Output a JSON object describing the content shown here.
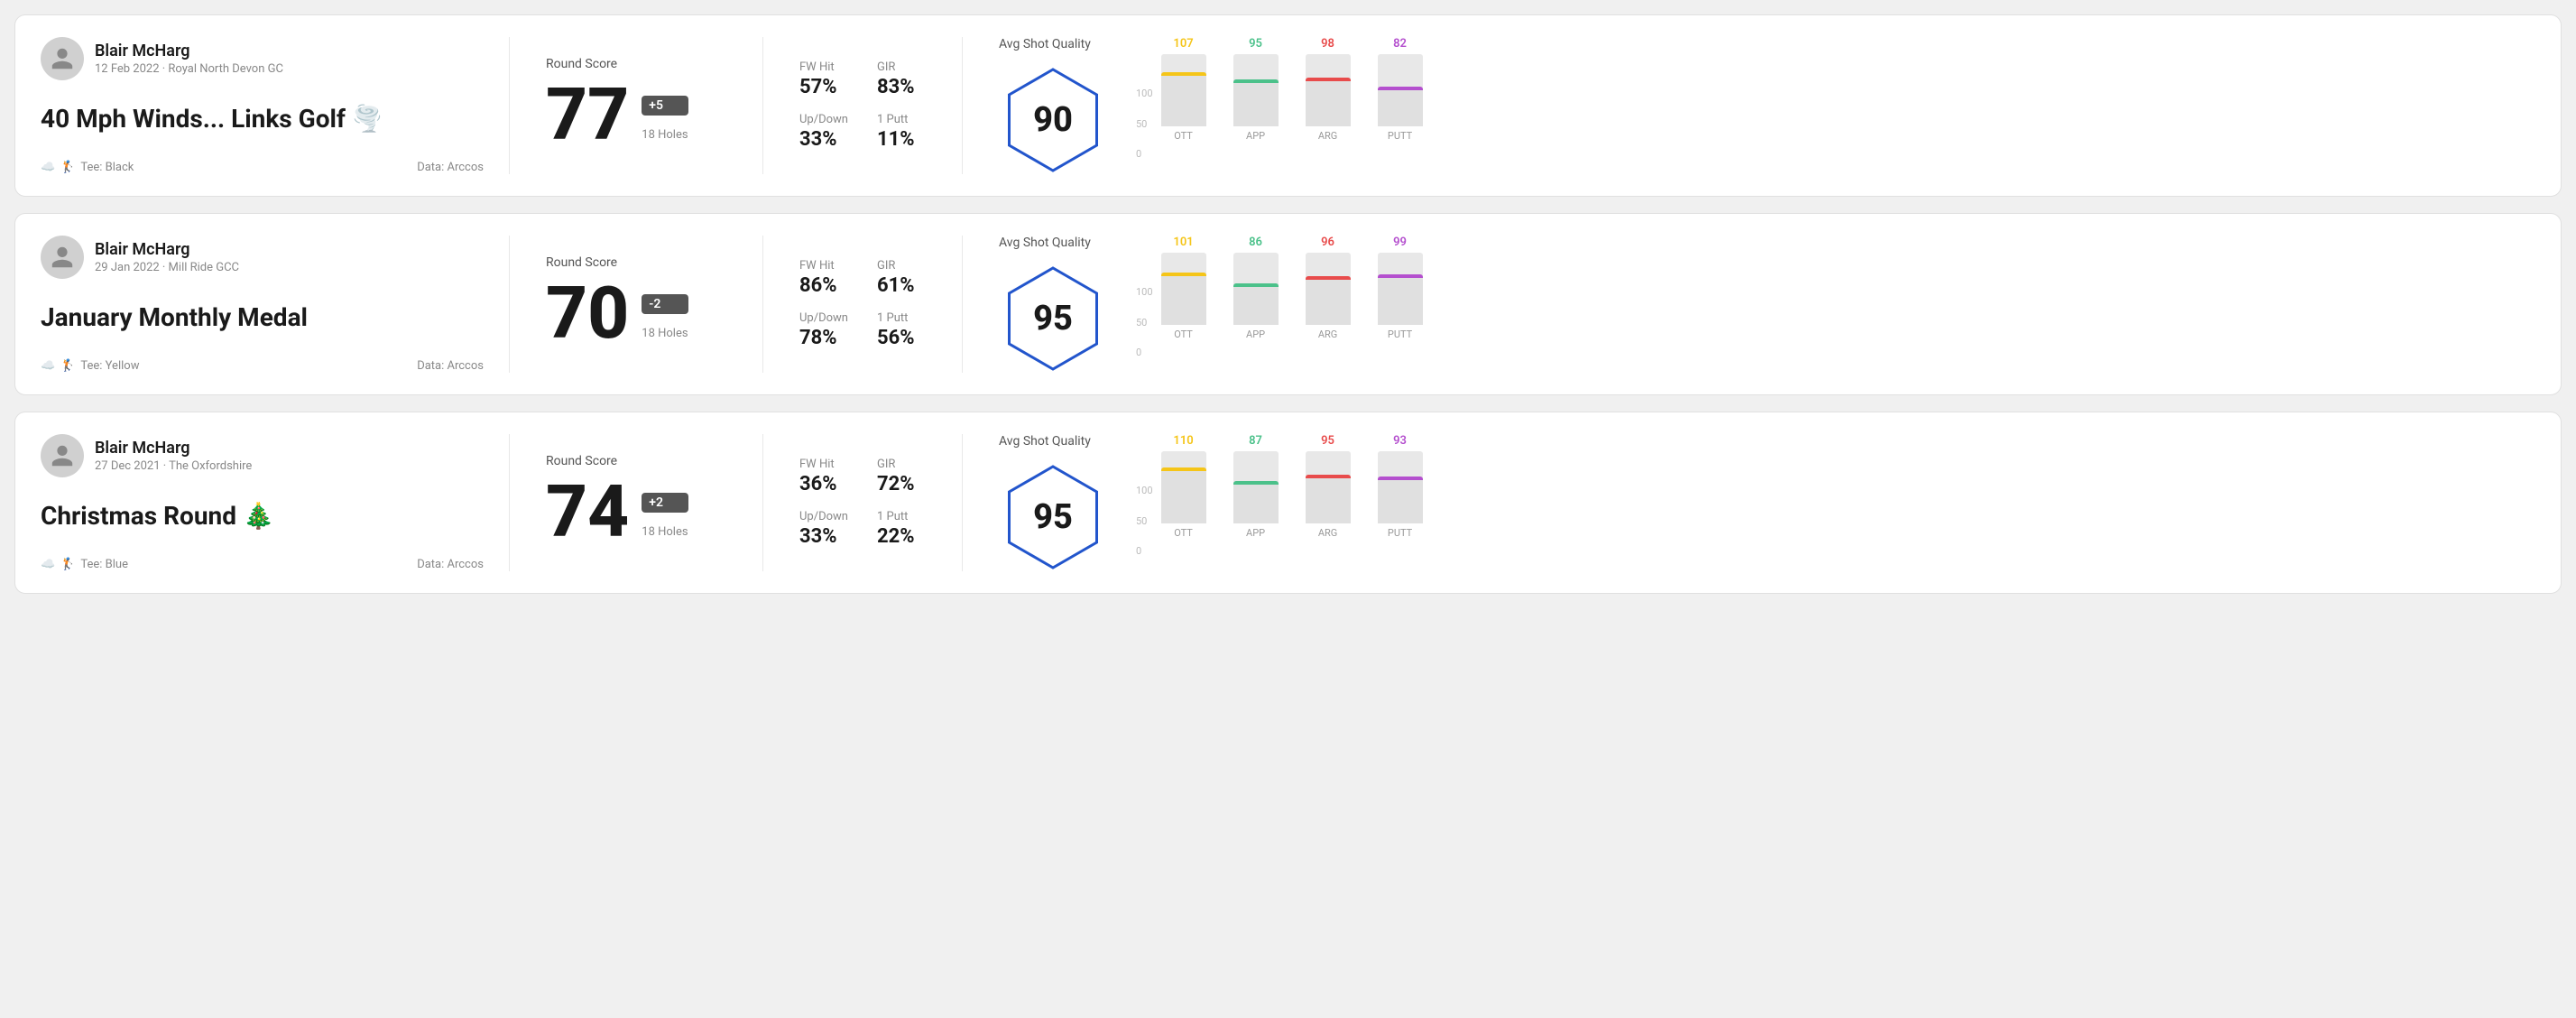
{
  "rounds": [
    {
      "id": "round1",
      "user": {
        "name": "Blair McHarg",
        "date_course": "12 Feb 2022 · Royal North Devon GC"
      },
      "title": "40 Mph Winds... Links Golf",
      "title_emoji": "🌪️",
      "tee": "Black",
      "data_source": "Data: Arccos",
      "round_score_label": "Round Score",
      "score": "77",
      "score_badge": "+5",
      "holes": "18 Holes",
      "stats": [
        {
          "label": "FW Hit",
          "value": "57%"
        },
        {
          "label": "GIR",
          "value": "83%"
        },
        {
          "label": "Up/Down",
          "value": "33%"
        },
        {
          "label": "1 Putt",
          "value": "11%"
        }
      ],
      "avg_shot_quality_label": "Avg Shot Quality",
      "quality_score": "90",
      "bars": [
        {
          "label": "OTT",
          "value": 107,
          "color": "#f5c518",
          "height_pct": 75
        },
        {
          "label": "APP",
          "value": 95,
          "color": "#4bc18a",
          "height_pct": 65
        },
        {
          "label": "ARG",
          "value": 98,
          "color": "#e84b4b",
          "height_pct": 68
        },
        {
          "label": "PUTT",
          "value": 82,
          "color": "#b44fce",
          "height_pct": 55
        }
      ],
      "chart_y": [
        "100",
        "50",
        "0"
      ]
    },
    {
      "id": "round2",
      "user": {
        "name": "Blair McHarg",
        "date_course": "29 Jan 2022 · Mill Ride GCC"
      },
      "title": "January Monthly Medal",
      "title_emoji": "",
      "tee": "Yellow",
      "data_source": "Data: Arccos",
      "round_score_label": "Round Score",
      "score": "70",
      "score_badge": "-2",
      "holes": "18 Holes",
      "stats": [
        {
          "label": "FW Hit",
          "value": "86%"
        },
        {
          "label": "GIR",
          "value": "61%"
        },
        {
          "label": "Up/Down",
          "value": "78%"
        },
        {
          "label": "1 Putt",
          "value": "56%"
        }
      ],
      "avg_shot_quality_label": "Avg Shot Quality",
      "quality_score": "95",
      "bars": [
        {
          "label": "OTT",
          "value": 101,
          "color": "#f5c518",
          "height_pct": 72
        },
        {
          "label": "APP",
          "value": 86,
          "color": "#4bc18a",
          "height_pct": 58
        },
        {
          "label": "ARG",
          "value": 96,
          "color": "#e84b4b",
          "height_pct": 67
        },
        {
          "label": "PUTT",
          "value": 99,
          "color": "#b44fce",
          "height_pct": 70
        }
      ],
      "chart_y": [
        "100",
        "50",
        "0"
      ]
    },
    {
      "id": "round3",
      "user": {
        "name": "Blair McHarg",
        "date_course": "27 Dec 2021 · The Oxfordshire"
      },
      "title": "Christmas Round",
      "title_emoji": "🎄",
      "tee": "Blue",
      "data_source": "Data: Arccos",
      "round_score_label": "Round Score",
      "score": "74",
      "score_badge": "+2",
      "holes": "18 Holes",
      "stats": [
        {
          "label": "FW Hit",
          "value": "36%"
        },
        {
          "label": "GIR",
          "value": "72%"
        },
        {
          "label": "Up/Down",
          "value": "33%"
        },
        {
          "label": "1 Putt",
          "value": "22%"
        }
      ],
      "avg_shot_quality_label": "Avg Shot Quality",
      "quality_score": "95",
      "bars": [
        {
          "label": "OTT",
          "value": 110,
          "color": "#f5c518",
          "height_pct": 78
        },
        {
          "label": "APP",
          "value": 87,
          "color": "#4bc18a",
          "height_pct": 59
        },
        {
          "label": "ARG",
          "value": 95,
          "color": "#e84b4b",
          "height_pct": 67
        },
        {
          "label": "PUTT",
          "value": 93,
          "color": "#b44fce",
          "height_pct": 65
        }
      ],
      "chart_y": [
        "100",
        "50",
        "0"
      ]
    }
  ]
}
